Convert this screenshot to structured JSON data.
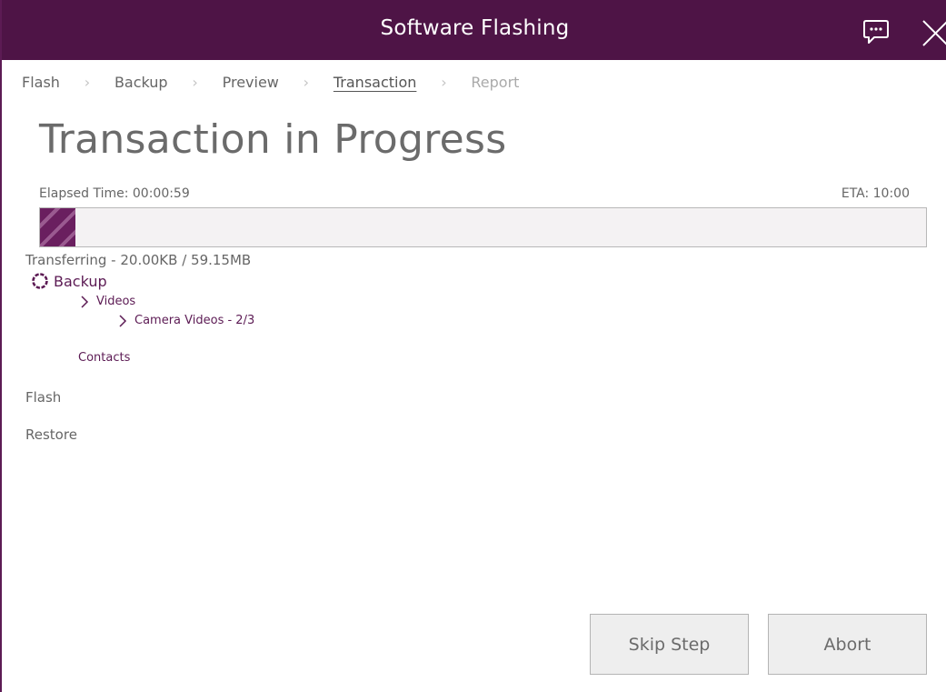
{
  "window": {
    "title": "Software Flashing"
  },
  "titlebar": {
    "feedback_icon": "speech-bubble-icon",
    "close_icon": "close-icon"
  },
  "breadcrumb": {
    "items": [
      {
        "label": "Flash",
        "state": "done"
      },
      {
        "label": "Backup",
        "state": "done"
      },
      {
        "label": "Preview",
        "state": "done"
      },
      {
        "label": "Transaction",
        "state": "current"
      },
      {
        "label": "Report",
        "state": "upcoming"
      }
    ],
    "separator_icon": "chevron-right-icon"
  },
  "page": {
    "title": "Transaction in Progress"
  },
  "progress": {
    "elapsed": "Elapsed Time: 00:00:59",
    "eta": "ETA: 10:00",
    "status": "Transferring - 20.00KB / 59.15MB",
    "fraction": 0.04
  },
  "tasks": {
    "backup": {
      "label": "Backup",
      "icon": "spinner-icon",
      "videos": {
        "label": "Videos"
      },
      "camera_videos": {
        "label": "Camera Videos - 2/3"
      },
      "contacts": {
        "label": "Contacts"
      }
    },
    "flash": {
      "label": "Flash"
    },
    "restore": {
      "label": "Restore"
    }
  },
  "buttons": {
    "skip": "Skip Step",
    "abort": "Abort"
  },
  "colors": {
    "accent": "#4e1446",
    "accent_text": "#5c1b54",
    "button_bg": "#eeeeee",
    "progress_stripe": "#9a5a90"
  }
}
